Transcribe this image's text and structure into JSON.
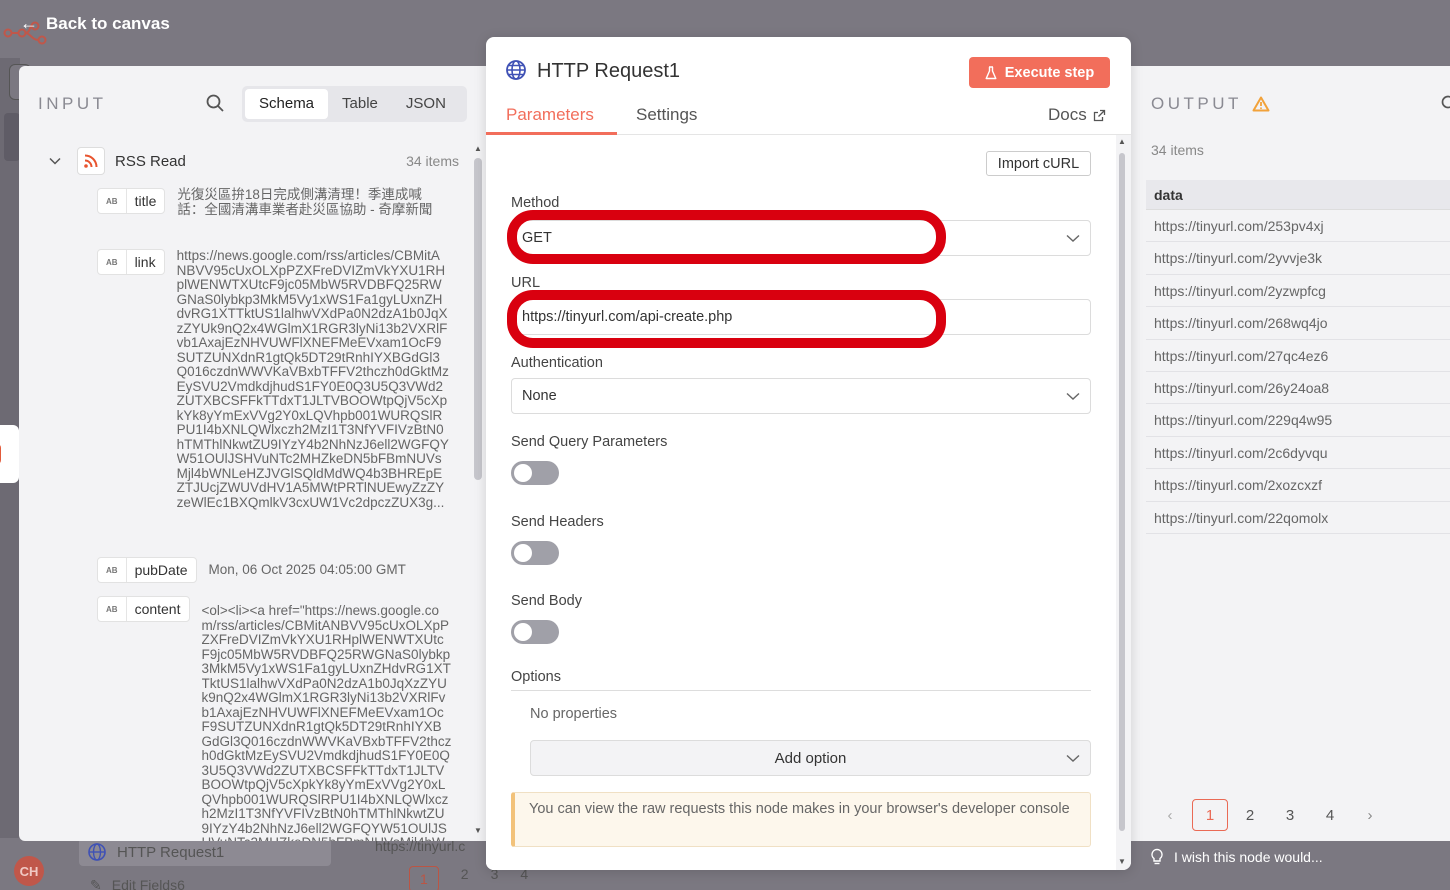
{
  "topbar": {
    "back_label": "Back to canvas"
  },
  "input": {
    "label": "INPUT",
    "tabs": [
      "Schema",
      "Table",
      "JSON"
    ],
    "active_tab": "Schema",
    "node_name": "RSS Read",
    "items_count": "34 items",
    "type_badge": "AB",
    "fields": [
      {
        "name": "title",
        "value": "光復災區拚18日完成側溝清理！季連成喊話：全國清溝車業者赴災區協助 - 奇摩新聞"
      },
      {
        "name": "link",
        "value": "https://news.google.com/rss/articles/CBMitANBVV95cUxOLXpPZXFreDVIZmVkYXU1RHplWENWTXUtcF9jc05MbW5RVDBFQ25RWGNaS0lybkp3MkM5Vy1xWS1Fa1gyLUxnZHdvRG1XTTktUS1lalhwVXdPa0N2dzA1b0JqXzZYUk9nQ2x4WGlmX1RGR3lyNi13b2VXRlFvb1AxajEzNHVUWFlXNEFMeEVxam1OcF9SUTZUNXdnR1gtQk5DT29tRnhIYXBGdGl3Q016czdnWWVKaVBxbTFFV2thczh0dGktMzEySVU2VmdkdjhudS1FY0E0Q3U5Q3VWd2ZUTXBCSFFkTTdxT1JLTVBOOWtpQjV5cXpkYk8yYmExVVg2Y0xLQVhpb001WURQSlRPU1I4bXNLQWlxczh2MzI1T3NfYVFIVzBtN0hTMThlNkwtZU9IYzY4b2NhNzJ6ell2WGFQYW51OUlJSHVuNTc2MHZkeDN5bFBmNUVsMjl4bWNLeHZJVGlSQldMdWQ4b3BHREpEZTJUcjZWUVdHV1A5MWtPRTlNUEwyZzZYzeWlEc1BXQmlkV3cxUW1Vc2dpczZUX3g..."
      },
      {
        "name": "pubDate",
        "value": "Mon, 06 Oct 2025 04:05:00 GMT"
      },
      {
        "name": "content",
        "value": "<ol><li><a href=\"https://news.google.com/rss/articles/CBMitANBVV95cUxOLXpPZXFreDVIZmVkYXU1RHplWENWTXUtcF9jc05MbW5RVDBFQ25RWGNaS0lybkp3MkM5Vy1xWS1Fa1gyLUxnZHdvRG1XTTktUS1lalhwVXdPa0N2dzA1b0JqXzZYUk9nQ2x4WGlmX1RGR3lyNi13b2VXRlFvb1AxajEzNHVUWFlXNEFMeEVxam1OcF9SUTZUNXdnR1gtQk5DT29tRnhIYXBGdGl3Q016czdnWWVKaVBxbTFFV2thczh0dGktMzEySVU2VmdkdjhudS1FY0E0Q3U5Q3VWd2ZUTXBCSFFkTTdxT1JLTVBOOWtpQjV5cXpkYk8yYmExVVg2Y0xLQVhpb001WURQSlRPU1I4bXNLQWlxczh2MzI1T3NfYVFIVzBtN0hTMThlNkwtZU9IYzY4b2NhNzJ6ell2WGFQYW51OUlJSHVuNTc2MHZkeDN5bFBmNUVsMjl4bWNL"
      }
    ]
  },
  "modal": {
    "title": "HTTP Request1",
    "execute_label": "Execute step",
    "tabs": {
      "parameters": "Parameters",
      "settings": "Settings",
      "docs": "Docs"
    },
    "import_curl": "Import cURL",
    "method_label": "Method",
    "method_value": "GET",
    "url_label": "URL",
    "url_value": "https://tinyurl.com/api-create.php",
    "auth_label": "Authentication",
    "auth_value": "None",
    "send_query_label": "Send Query Parameters",
    "send_headers_label": "Send Headers",
    "send_body_label": "Send Body",
    "toggles": {
      "send_query": false,
      "send_headers": false,
      "send_body": false
    },
    "options_label": "Options",
    "no_properties": "No properties",
    "add_option": "Add option",
    "notice": "You can view the raw requests this node makes in your browser's developer console",
    "annotation_color": "#d9000f"
  },
  "output": {
    "label": "OUTPUT",
    "items_count": "34 items",
    "column": "data",
    "rows": [
      "https://tinyurl.com/253pv4xj",
      "https://tinyurl.com/2yvvje3k",
      "https://tinyurl.com/2yzwpfcg",
      "https://tinyurl.com/268wq4jo",
      "https://tinyurl.com/27qc4ez6",
      "https://tinyurl.com/26y24oa8",
      "https://tinyurl.com/229q4w95",
      "https://tinyurl.com/2c6dyvqu",
      "https://tinyurl.com/2xozcxzf",
      "https://tinyurl.com/22qomolx"
    ],
    "pages": [
      "1",
      "2",
      "3",
      "4"
    ],
    "active_page": "1",
    "feedback": "I wish this node would..."
  },
  "behind": {
    "node_item_1": "HTTP Request1",
    "node_item_2": "Edit Fields6",
    "avatar": "CH",
    "url_fragment": "https://tinyurl.c",
    "pages": [
      "1",
      "2",
      "3",
      "4"
    ]
  },
  "colors": {
    "accent": "#f26e5b",
    "warning": "#f2a23a",
    "rss": "#e8542f",
    "globe": "#3f51b5"
  }
}
